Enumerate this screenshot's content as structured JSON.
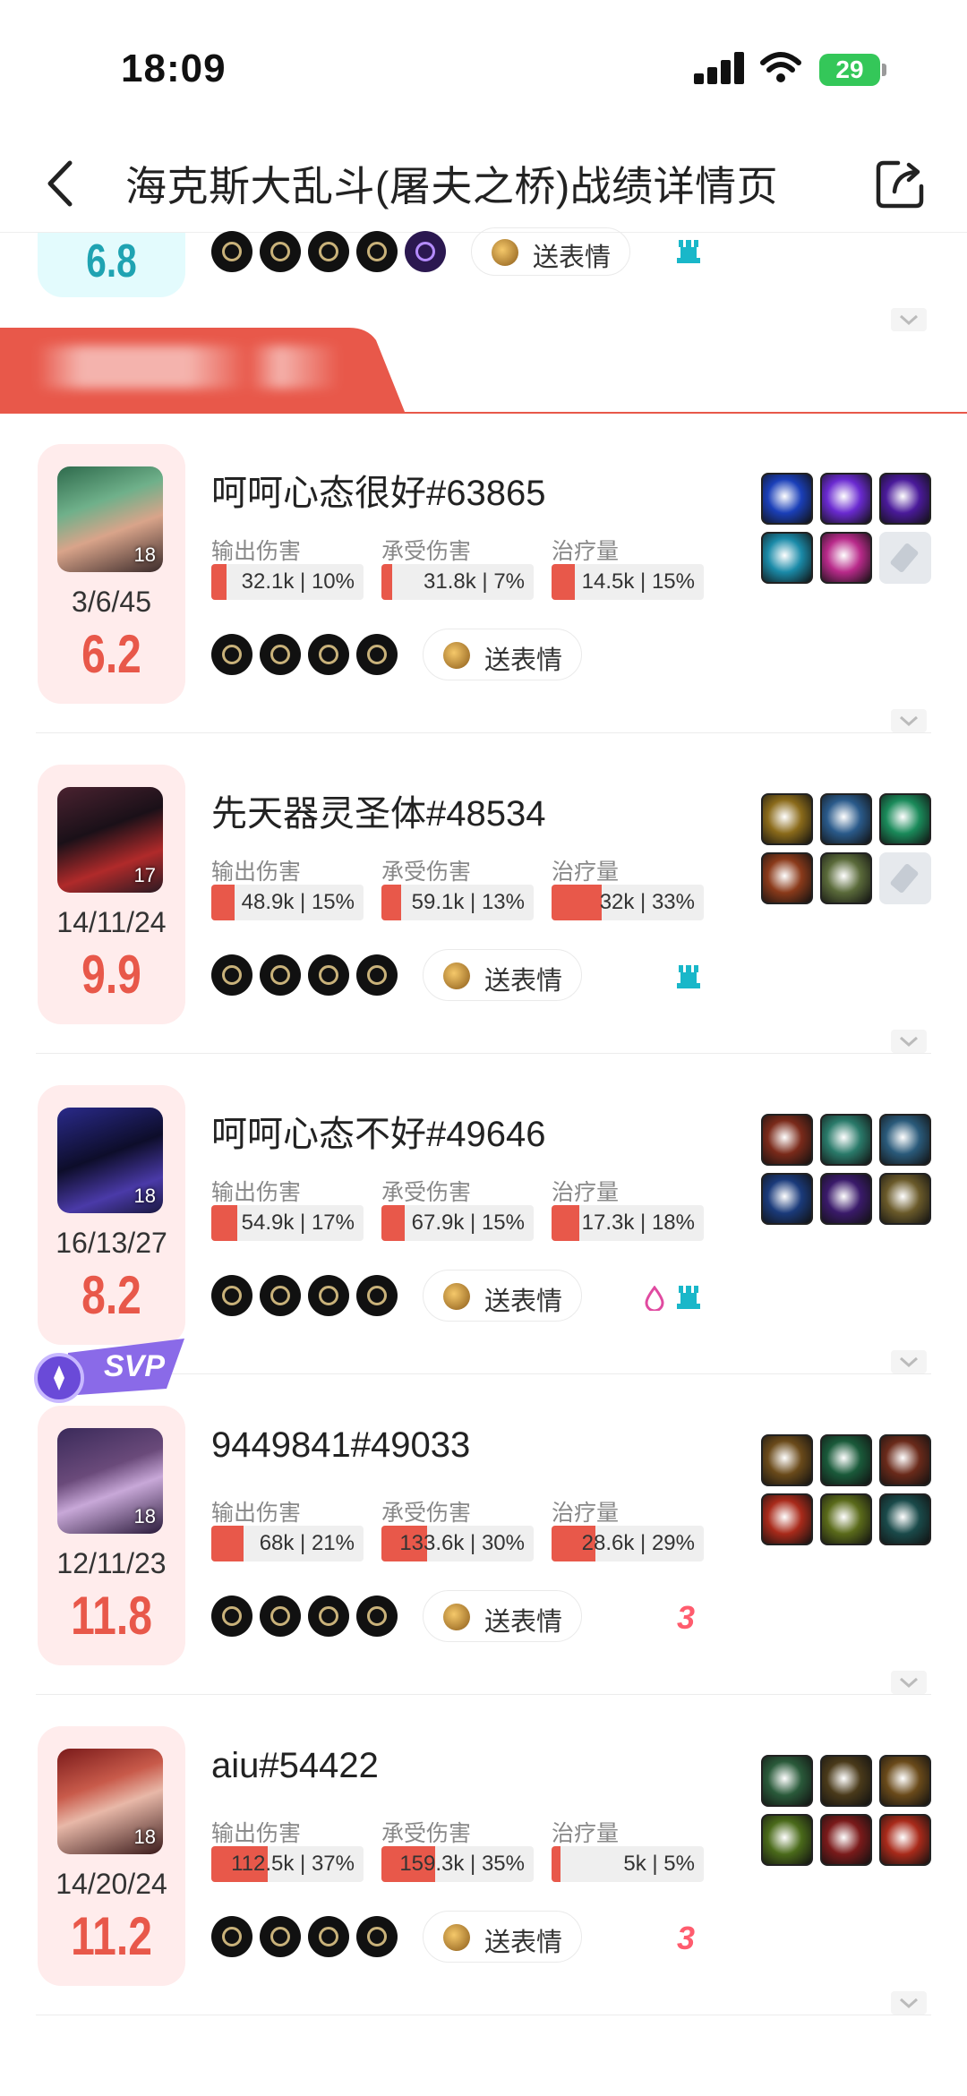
{
  "status_bar": {
    "time": "18:09",
    "battery": "29"
  },
  "nav": {
    "title": "海克斯大乱斗(屠夫之桥)战绩详情页"
  },
  "partial_card": {
    "score": "6.8",
    "emote_label": "送表情"
  },
  "colors": {
    "accent": "#e8584a",
    "banner": "#e8584a",
    "cyan": "#19b7c9",
    "score_bg": "#ffecec"
  },
  "stat_labels": {
    "damage": "输出伤害",
    "taken": "承受伤害",
    "heal": "治疗量"
  },
  "players": [
    {
      "name": "呵呵心态很好#63865",
      "level": "18",
      "kda": "3/6/45",
      "score": "6.2",
      "damage": {
        "text": "32.1k | 10%",
        "fraction": 0.1
      },
      "taken": {
        "text": "31.8k | 7%",
        "fraction": 0.07
      },
      "heal": {
        "text": "14.5k | 15%",
        "fraction": 0.15
      },
      "emote_label": "送表情",
      "badge": "none",
      "item_icons": [
        "blue-orb-item-icon",
        "purple-claw-item-icon",
        "purple-swirl-item-icon",
        "teal-droplet-item-icon",
        "pink-flower-item-icon",
        "empty-slot-icon"
      ]
    },
    {
      "name": "先天器灵圣体#48534",
      "level": "17",
      "kda": "14/11/24",
      "score": "9.9",
      "damage": {
        "text": "48.9k | 15%",
        "fraction": 0.15
      },
      "taken": {
        "text": "59.1k | 13%",
        "fraction": 0.13
      },
      "heal": {
        "text": "32k | 33%",
        "fraction": 0.33
      },
      "emote_label": "送表情",
      "badge": "tower",
      "item_icons": [
        "gold-blade-item-icon",
        "sword-item-icon",
        "green-wing-item-icon",
        "red-gold-blade-item-icon",
        "spear-item-icon",
        "empty-slot-icon"
      ]
    },
    {
      "name": "呵呵心态不好#49646",
      "level": "18",
      "kda": "16/13/27",
      "score": "8.2",
      "damage": {
        "text": "54.9k | 17%",
        "fraction": 0.17
      },
      "taken": {
        "text": "67.9k | 15%",
        "fraction": 0.15
      },
      "heal": {
        "text": "17.3k | 18%",
        "fraction": 0.18
      },
      "emote_label": "送表情",
      "badge": "drop-tower",
      "item_icons": [
        "horn-helm-item-icon",
        "green-sigil-item-icon",
        "cannon-item-icon",
        "blue-shield-item-icon",
        "dark-crystal-item-icon",
        "gold-lance-item-icon"
      ]
    },
    {
      "name": "9449841#49033",
      "level": "18",
      "kda": "12/11/23",
      "score": "11.8",
      "damage": {
        "text": "68k | 21%",
        "fraction": 0.21
      },
      "taken": {
        "text": "133.6k | 30%",
        "fraction": 0.3
      },
      "heal": {
        "text": "28.6k | 29%",
        "fraction": 0.29
      },
      "emote_label": "送表情",
      "badge": "three",
      "badge_text": "3",
      "svp": "SVP",
      "item_icons": [
        "gold-helm-item-icon",
        "green-chain-item-icon",
        "red-mask-item-icon",
        "fire-heart-item-icon",
        "gold-claw-item-icon",
        "dark-tower-item-icon"
      ]
    },
    {
      "name": "aiu#54422",
      "level": "18",
      "kda": "14/20/24",
      "score": "11.2",
      "damage": {
        "text": "112.5k | 37%",
        "fraction": 0.37
      },
      "taken": {
        "text": "159.3k | 35%",
        "fraction": 0.35
      },
      "heal": {
        "text": "5k | 5%",
        "fraction": 0.05
      },
      "emote_label": "送表情",
      "badge": "three",
      "badge_text": "3",
      "item_icons": [
        "green-axe-item-icon",
        "boots-item-icon",
        "gold-helm-item-icon",
        "green-claw-item-icon",
        "red-blade-item-icon",
        "fire-heart-item-icon"
      ]
    }
  ]
}
